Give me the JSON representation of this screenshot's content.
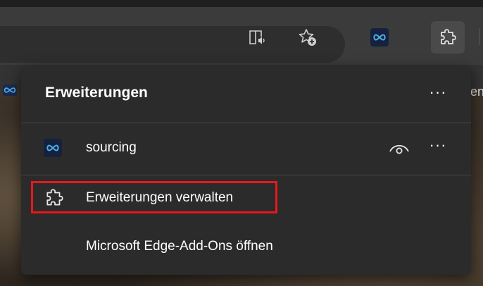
{
  "toolbar": {
    "read_aloud_icon": "read-aloud-icon",
    "favorites_icon": "add-favorite-icon",
    "extension_icon": "sourcing-extension-icon",
    "extensions_icon": "puzzle-icon"
  },
  "favorites_bar": {
    "right_peek_text": "en"
  },
  "extensions_menu": {
    "title": "Erweiterungen",
    "more_label": "···",
    "extensions": [
      {
        "name": "sourcing",
        "more_label": "···"
      }
    ],
    "items": [
      {
        "label": "Erweiterungen verwalten",
        "icon": "puzzle-icon",
        "highlighted": true
      },
      {
        "label": "Microsoft Edge-Add-Ons öffnen"
      }
    ]
  },
  "colors": {
    "highlight": "#e8181c",
    "menu_bg": "#2b2b2b",
    "toolbar_bg": "#3b3b3b"
  }
}
